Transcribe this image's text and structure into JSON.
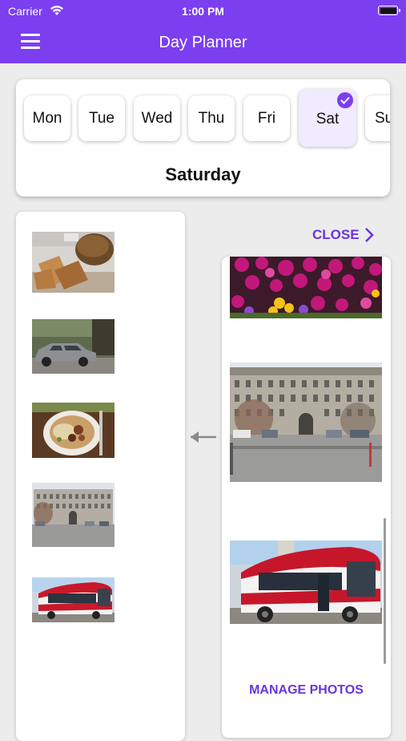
{
  "status_bar": {
    "carrier": "Carrier",
    "time": "1:00 PM"
  },
  "nav": {
    "title": "Day Planner",
    "menu_icon": "hamburger-icon"
  },
  "days": [
    {
      "label": "Mon",
      "selected": false
    },
    {
      "label": "Tue",
      "selected": false
    },
    {
      "label": "Wed",
      "selected": false
    },
    {
      "label": "Thu",
      "selected": false
    },
    {
      "label": "Fri",
      "selected": false
    },
    {
      "label": "Sat",
      "selected": true
    },
    {
      "label": "Su",
      "selected": false
    }
  ],
  "selected_day_name": "Saturday",
  "left_list": {
    "items": [
      "bread-photo",
      "car-photo",
      "food-plate-photo",
      "building-photo",
      "bus-photo"
    ]
  },
  "right_panel": {
    "close_label": "CLOSE",
    "items": [
      "flowers-photo",
      "building-photo",
      "bus-photo"
    ],
    "manage_label": "MANAGE PHOTOS"
  },
  "colors": {
    "accent": "#7b3ff0",
    "link": "#6a35e0",
    "selected_day_bg": "#f0ebff"
  }
}
